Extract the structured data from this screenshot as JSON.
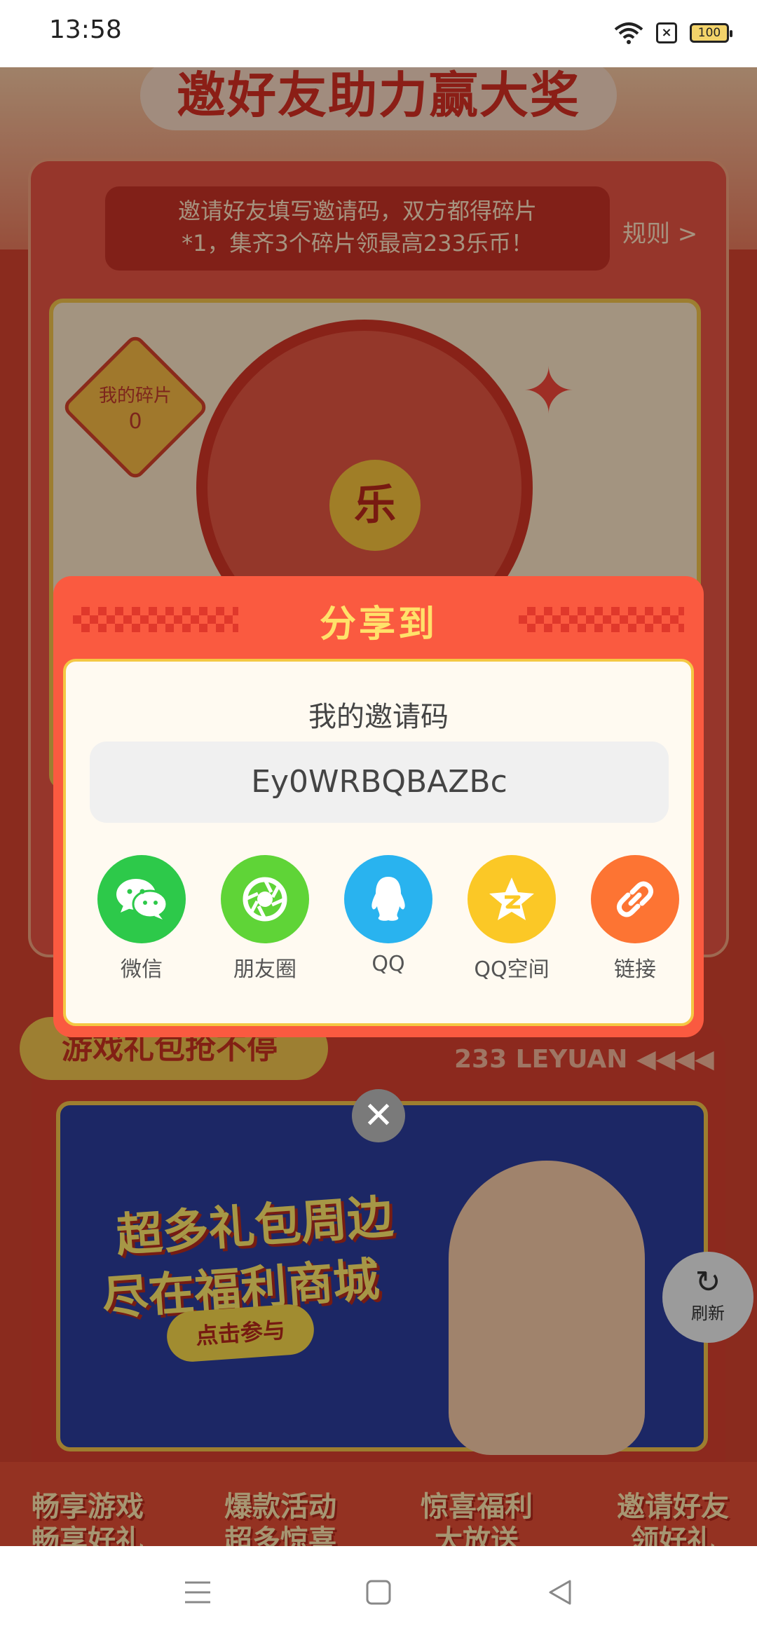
{
  "status_bar": {
    "time": "13:58",
    "battery": "100"
  },
  "background": {
    "banner_title": "邀好友助力赢大奖",
    "tip_line1": "邀请好友填写邀请码，双方都得碎片",
    "tip_line2": "*1，集齐3个碎片领最高233乐币！",
    "rules_link": "规则 >",
    "fragments_label": "我的碎片",
    "fragments_count": "0",
    "wheel_center": "乐",
    "section2_title": "游戏礼包抢不停",
    "leyuan_text": "233 LEYUAN",
    "promo_line1": "超多礼包周边",
    "promo_line2": "尽在福利商城",
    "promo_button": "点击参与",
    "refresh_label": "刷新",
    "features": [
      {
        "line1": "畅享游戏",
        "line2": "畅享好礼"
      },
      {
        "line1": "爆款活动",
        "line2": "超多惊喜"
      },
      {
        "line1": "惊喜福利",
        "line2": "大放送"
      },
      {
        "line1": "邀请好友",
        "line2": "领好礼"
      }
    ]
  },
  "dialog": {
    "title": "分享到",
    "code_label": "我的邀请码",
    "invite_code": "Ey0WRBQBAZBc",
    "share_options": [
      {
        "label": "微信",
        "icon": "wechat-icon",
        "color": "#2dc94a"
      },
      {
        "label": "朋友圈",
        "icon": "moments-icon",
        "color": "#5fd437"
      },
      {
        "label": "QQ",
        "icon": "qq-icon",
        "color": "#29b3ef"
      },
      {
        "label": "QQ空间",
        "icon": "qzone-icon",
        "color": "#fbc826"
      },
      {
        "label": "链接",
        "icon": "link-icon",
        "color": "#fd7433"
      }
    ]
  },
  "colors": {
    "dialog_bg": "#fa5a40",
    "title_yellow": "#ffe16a",
    "card_border": "#f4c844"
  }
}
